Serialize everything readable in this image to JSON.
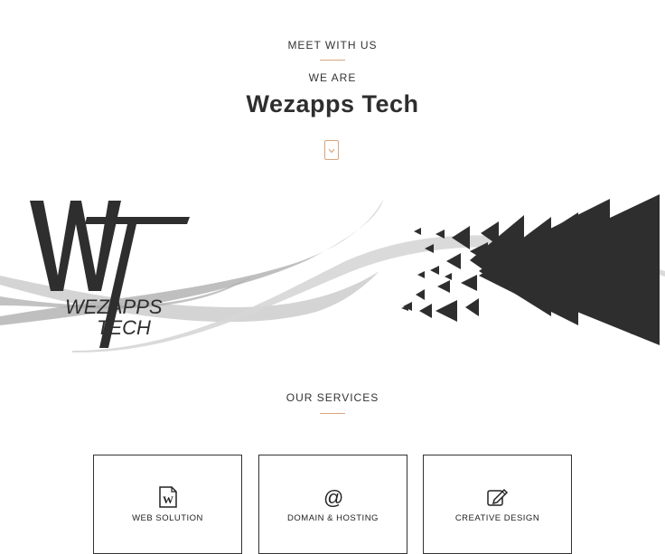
{
  "hero": {
    "meet_label": "MEET WITH US",
    "we_are_label": "WE ARE",
    "title": "Wezapps Tech"
  },
  "banner": {
    "logo_letters": "WT",
    "logo_line1": "WEZAPPS",
    "logo_line2": "TECH"
  },
  "services": {
    "heading": "OUR SERVICES",
    "items": [
      {
        "label": "WEB SOLUTION",
        "icon": "word-document-icon",
        "desc": ""
      },
      {
        "label": "DOMAIN & HOSTING",
        "icon": "at-sign-icon",
        "desc": ""
      },
      {
        "label": "CREATIVE DESIGN",
        "icon": "edit-pencil-icon",
        "desc": ""
      }
    ]
  },
  "colors": {
    "accent": "#d9a47f",
    "text": "#333333",
    "logo_dark": "#2e2e2e"
  }
}
